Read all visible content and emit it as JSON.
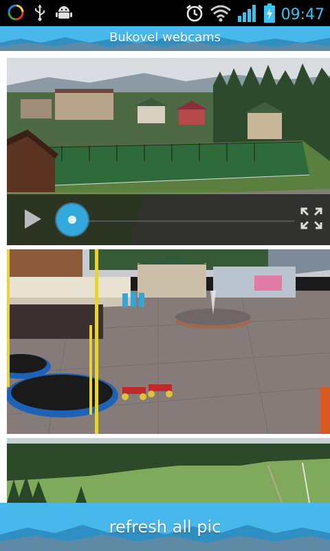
{
  "status_bar": {
    "time": "09:47",
    "icons": [
      "app-circle-icon",
      "usb-icon",
      "android-icon",
      "alarm-icon",
      "wifi-icon",
      "signal-icon",
      "battery-charging-icon"
    ]
  },
  "header": {
    "title": "Bukovel webcams"
  },
  "webcams": [
    {
      "name": "webcam-1"
    },
    {
      "name": "webcam-2"
    },
    {
      "name": "webcam-3"
    }
  ],
  "player": {
    "progress": 0.0
  },
  "footer": {
    "refresh_label": "refresh all pic"
  },
  "colors": {
    "accent": "#48b8ec",
    "status_time": "#39c3f0",
    "seek_thumb": "#32a8dd"
  }
}
